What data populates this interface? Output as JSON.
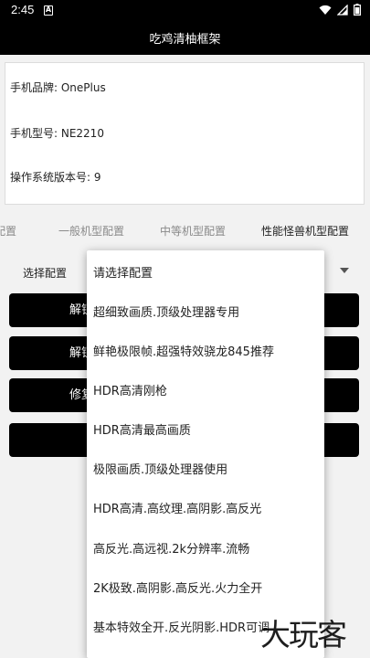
{
  "status": {
    "time": "2:45",
    "notification_letter": "A"
  },
  "app_title": "吃鸡清柚框架",
  "device": {
    "brand": "手机品牌: OnePlus",
    "model": "手机型号: NE2210",
    "os_version": "操作系统版本号: 9"
  },
  "tabs": [
    "配置",
    "一般机型配置",
    "中等机型配置",
    "性能怪兽机型配置"
  ],
  "select_label": "选择配置",
  "buttons": [
    "解锁",
    "解锁",
    "修复",
    ""
  ],
  "dropdown_options": [
    "请选择配置",
    "超细致画质.顶级处理器专用",
    "鲜艳极限帧.超强特效骁龙845推荐",
    "HDR高清刚枪",
    "HDR高清最高画质",
    "极限画质.顶级处理器使用",
    "HDR高清.高纹理.高阴影.高反光",
    "高反光.高远视.2k分辨率.流畅",
    "2K极致.高阴影.高反光.火力全开",
    "基本特效全开.反光阴影.HDR可调"
  ],
  "watermark": "大玩客"
}
